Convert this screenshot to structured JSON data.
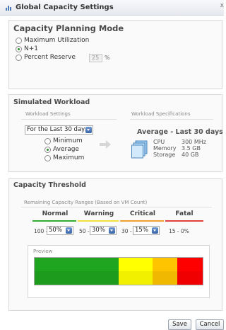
{
  "window": {
    "title": "Global Capacity Settings",
    "close_glyph": "x"
  },
  "planning": {
    "title": "Capacity Planning Mode",
    "options": [
      "Maximum Utilization",
      "N+1",
      "Percent Reserve"
    ],
    "selected": "N+1",
    "reserve_value": "25",
    "reserve_unit": "%"
  },
  "workload": {
    "title": "Simulated Workload",
    "settings_label": "Workload Settings",
    "specs_label": "Workload Specifications",
    "period_select": "For the Last 30 days",
    "options": [
      "Minimum",
      "Average",
      "Maximum"
    ],
    "selected": "Average",
    "spec_title": "Average - Last 30 days",
    "specs": [
      {
        "name": "CPU",
        "value": "300 MHz"
      },
      {
        "name": "Memory",
        "value": "3.5 GB"
      },
      {
        "name": "Storage",
        "value": "40 GB"
      }
    ]
  },
  "threshold": {
    "title": "Capacity Threshold",
    "ranges_label": "Remaining Capacity Ranges (Based on VM Count)",
    "levels": [
      {
        "name": "Normal",
        "range_start": "100 -",
        "select": "50%",
        "color": "#33aa33"
      },
      {
        "name": "Warning",
        "range_start": "50 -",
        "select": "30%",
        "color": "#f0e040"
      },
      {
        "name": "Critical",
        "range_start": "30 -",
        "select": "15%",
        "color": "#f0a030"
      },
      {
        "name": "Fatal",
        "range_text": "15 - 0%",
        "color": "#e04040"
      }
    ],
    "preview_label": "Preview",
    "preview_segments": [
      {
        "name": "Normal",
        "fraction": 0.5,
        "color": "#1fa51f"
      },
      {
        "name": "Warning",
        "fraction": 0.2,
        "color": "#ffff00"
      },
      {
        "name": "Critical",
        "fraction": 0.15,
        "color": "#ffc400"
      },
      {
        "name": "Fatal",
        "fraction": 0.15,
        "color": "#ff0000"
      }
    ]
  },
  "buttons": {
    "save": "Save",
    "cancel": "Cancel"
  },
  "icons": {
    "window": "bar-chart-icon",
    "workload": "server-stack-icon",
    "arrow": "right-arrow-icon",
    "dropdown": "chevron-down-icon"
  }
}
